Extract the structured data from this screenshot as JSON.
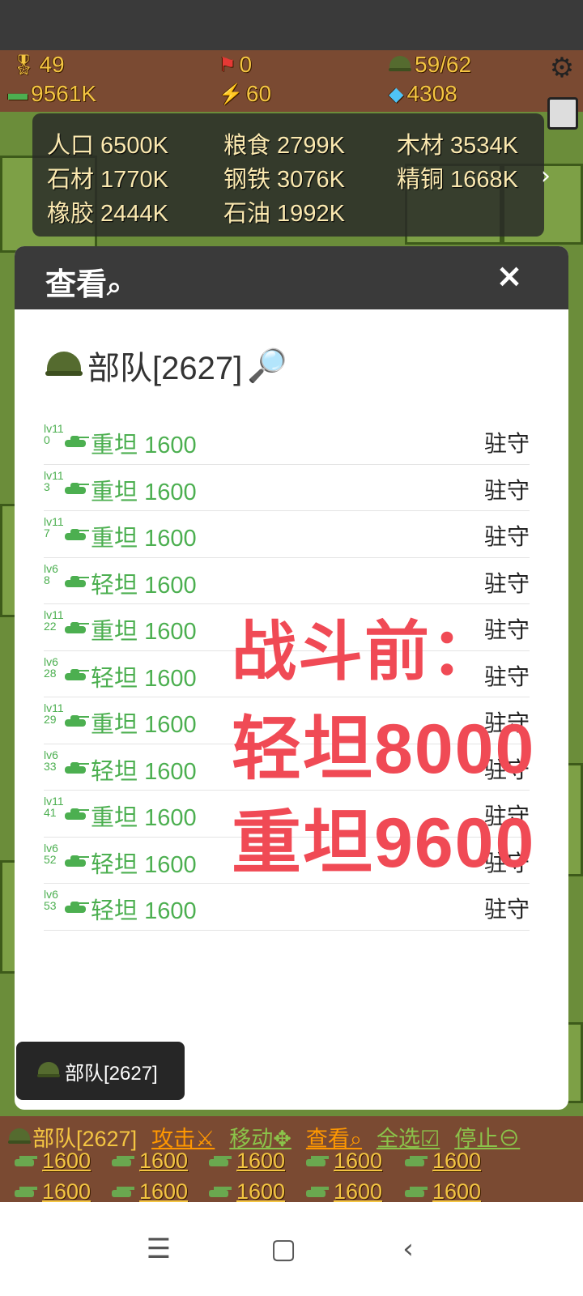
{
  "hud": {
    "medals": "49",
    "flags": "0",
    "troops": "59/62",
    "cash": "9561K",
    "energy": "60",
    "gems": "4308"
  },
  "resources": [
    {
      "label": "人口 6500K"
    },
    {
      "label": "粮食 2799K"
    },
    {
      "label": "木材 3534K"
    },
    {
      "label": "石材 1770K"
    },
    {
      "label": "钢铁 3076K"
    },
    {
      "label": "精铜 1668K"
    },
    {
      "label": "橡胶 2444K"
    },
    {
      "label": "石油 1992K"
    }
  ],
  "modal": {
    "title": "查看",
    "close_label": "×",
    "section_title": "部队[2627]"
  },
  "units": [
    {
      "lv": "lv11",
      "idx": "0",
      "type": "重坦",
      "count": "1600",
      "state": "驻守"
    },
    {
      "lv": "lv11",
      "idx": "3",
      "type": "重坦",
      "count": "1600",
      "state": "驻守"
    },
    {
      "lv": "lv11",
      "idx": "7",
      "type": "重坦",
      "count": "1600",
      "state": "驻守"
    },
    {
      "lv": "lv6",
      "idx": "8",
      "type": "轻坦",
      "count": "1600",
      "state": "驻守"
    },
    {
      "lv": "lv11",
      "idx": "22",
      "type": "重坦",
      "count": "1600",
      "state": "驻守"
    },
    {
      "lv": "lv6",
      "idx": "28",
      "type": "轻坦",
      "count": "1600",
      "state": "驻守"
    },
    {
      "lv": "lv11",
      "idx": "29",
      "type": "重坦",
      "count": "1600",
      "state": "驻守"
    },
    {
      "lv": "lv6",
      "idx": "33",
      "type": "轻坦",
      "count": "1600",
      "state": "驻守"
    },
    {
      "lv": "lv11",
      "idx": "41",
      "type": "重坦",
      "count": "1600",
      "state": "驻守"
    },
    {
      "lv": "lv6",
      "idx": "52",
      "type": "轻坦",
      "count": "1600",
      "state": "驻守"
    },
    {
      "lv": "lv6",
      "idx": "53",
      "type": "轻坦",
      "count": "1600",
      "state": "驻守"
    }
  ],
  "overlay": {
    "line1": "战斗前：",
    "line2": "轻坦8000",
    "line3": "重坦9600"
  },
  "toast": {
    "text": "部队[2627]"
  },
  "action_bar": {
    "unit_label": "部队[2627]",
    "attack": "攻击⚔",
    "move": "移动✥",
    "view": "查看⌕",
    "select_all": "全选☑",
    "stop": "停止⊖"
  },
  "chips": [
    "1600",
    "1600",
    "1600",
    "1600",
    "1600",
    "1600",
    "1600",
    "1600",
    "1600",
    "1600"
  ],
  "colors": {
    "unit_green": "#4caf50",
    "overlay_red": "#f04a55",
    "hud_gold": "#f4c542",
    "attack_orange": "#ff9800"
  }
}
